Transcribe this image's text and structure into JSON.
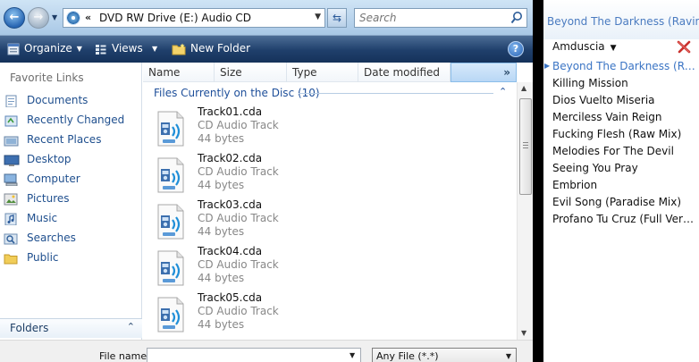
{
  "address": {
    "chevrons": "«",
    "path": "DVD RW Drive (E:) Audio CD"
  },
  "search": {
    "placeholder": "Search"
  },
  "toolbar": {
    "organize_label": "Organize",
    "views_label": "Views",
    "new_folder_label": "New Folder",
    "help_label": "?"
  },
  "nav": {
    "favorites_title": "Favorite Links",
    "links": [
      {
        "label": "Documents",
        "icon": "documents-icon"
      },
      {
        "label": "Recently Changed",
        "icon": "recently-changed-icon"
      },
      {
        "label": "Recent Places",
        "icon": "recent-places-icon"
      },
      {
        "label": "Desktop",
        "icon": "desktop-icon"
      },
      {
        "label": "Computer",
        "icon": "computer-icon"
      },
      {
        "label": "Pictures",
        "icon": "pictures-icon"
      },
      {
        "label": "Music",
        "icon": "music-icon"
      },
      {
        "label": "Searches",
        "icon": "searches-icon"
      },
      {
        "label": "Public",
        "icon": "public-icon"
      }
    ],
    "folders_label": "Folders"
  },
  "columns": [
    "Name",
    "Size",
    "Type",
    "Date modified"
  ],
  "columns_more": "»",
  "group_title": "Files Currently on the Disc (10)",
  "files": [
    {
      "name": "Track01.cda",
      "type": "CD Audio Track",
      "size": "44 bytes"
    },
    {
      "name": "Track02.cda",
      "type": "CD Audio Track",
      "size": "44 bytes"
    },
    {
      "name": "Track03.cda",
      "type": "CD Audio Track",
      "size": "44 bytes"
    },
    {
      "name": "Track04.cda",
      "type": "CD Audio Track",
      "size": "44 bytes"
    },
    {
      "name": "Track05.cda",
      "type": "CD Audio Track",
      "size": "44 bytes"
    }
  ],
  "bottom": {
    "file_name_label": "File name:",
    "file_name_value": "",
    "file_type_value": "Any File (*.*)"
  },
  "media": {
    "header_title": "Beyond The Darkness (Raving...",
    "artist": "Amduscia",
    "tracks": [
      "Beyond The Darkness (Raving Mix)",
      "Killing Mission",
      "Dios Vuelto Miseria",
      "Merciless Vain Reign",
      "Fucking Flesh (Raw Mix)",
      "Melodies For The Devil",
      "Seeing You Pray",
      "Embrion",
      "Evil Song (Paradise Mix)",
      "Profano Tu Cruz (Full Version)"
    ],
    "current_index": 0
  },
  "colors": {
    "accent": "#3a74c4",
    "toolbar": "#1f3f6b",
    "link": "#1f4f8e"
  }
}
